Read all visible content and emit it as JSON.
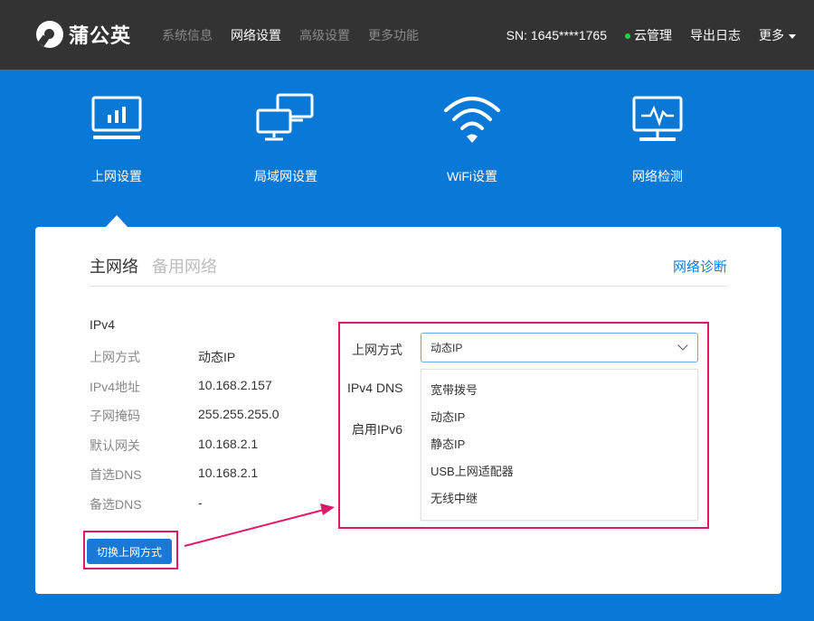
{
  "header": {
    "brand": "蒲公英",
    "nav": [
      "系统信息",
      "网络设置",
      "高级设置",
      "更多功能"
    ],
    "active_nav_index": 1,
    "sn_label": "SN:",
    "sn_value": "1645****1765",
    "cloud": "云管理",
    "export_log": "导出日志",
    "more": "更多"
  },
  "categories": [
    {
      "label": "上网设置",
      "icon": "monitor-chart-icon"
    },
    {
      "label": "局域网设置",
      "icon": "lan-computers-icon"
    },
    {
      "label": "WiFi设置",
      "icon": "wifi-icon"
    },
    {
      "label": "网络检测",
      "icon": "network-monitor-icon"
    }
  ],
  "panel": {
    "tab_main": "主网络",
    "tab_backup": "备用网络",
    "diagnose_link": "网络诊断",
    "ipv4_heading": "IPv4",
    "info": [
      {
        "key": "上网方式",
        "value": "动态IP"
      },
      {
        "key": "IPv4地址",
        "value": "10.168.2.157"
      },
      {
        "key": "子网掩码",
        "value": "255.255.255.0"
      },
      {
        "key": "默认网关",
        "value": "10.168.2.1"
      },
      {
        "key": "首选DNS",
        "value": "10.168.2.1"
      },
      {
        "key": "备选DNS",
        "value": "-"
      }
    ],
    "switch_button": "切换上网方式"
  },
  "form": {
    "mode_label": "上网方式",
    "dns_label": "IPv4 DNS",
    "ipv6_label": "启用IPv6",
    "selected": "动态IP",
    "options": [
      "宽带拨号",
      "动态IP",
      "静态IP",
      "USB上网适配器",
      "无线中继"
    ]
  },
  "colors": {
    "background": "#0a78d6",
    "topbar": "#333333",
    "accent": "#1a78d6",
    "highlight": "#e0186c",
    "status_online": "#22d04a"
  }
}
